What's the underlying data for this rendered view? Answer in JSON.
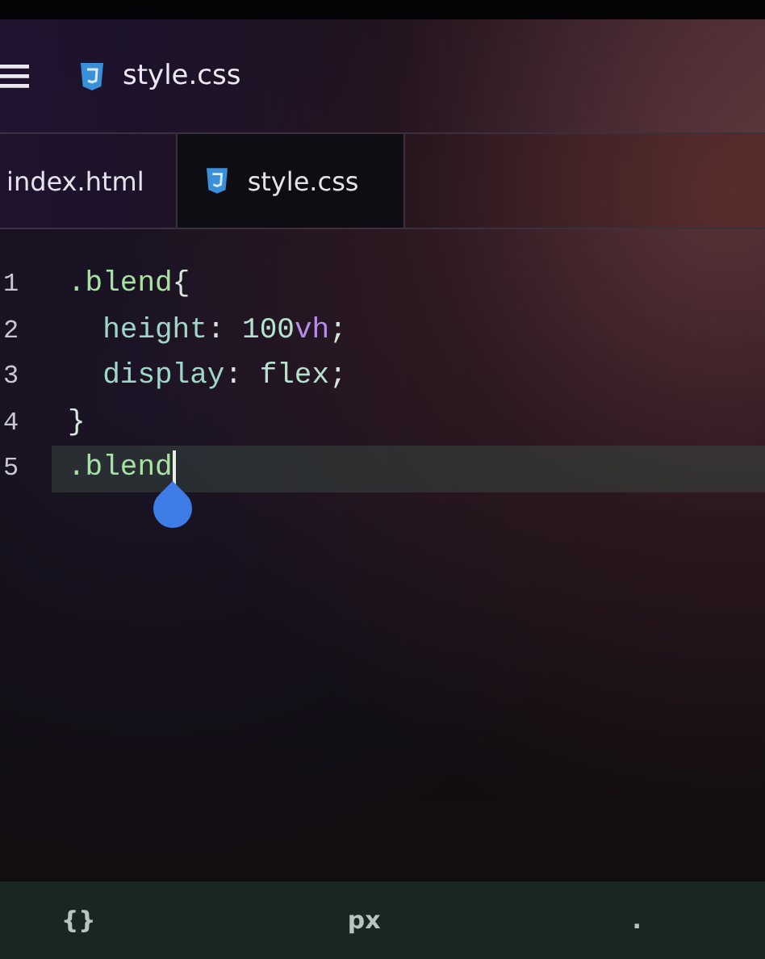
{
  "header": {
    "title": "style.css"
  },
  "tabs": [
    {
      "label": "index.html",
      "kind": "html",
      "selected": false
    },
    {
      "label": "style.css",
      "kind": "css",
      "selected": true
    }
  ],
  "editor": {
    "lines": [
      {
        "number": "1",
        "current": false,
        "tokens": [
          {
            "text": ".blend",
            "kind": "selector"
          },
          {
            "text": "{",
            "kind": "punct"
          }
        ]
      },
      {
        "number": "2",
        "current": false,
        "tokens": [
          {
            "text": "  height",
            "kind": "property"
          },
          {
            "text": ": ",
            "kind": "punct"
          },
          {
            "text": "100",
            "kind": "value"
          },
          {
            "text": "vh",
            "kind": "unit"
          },
          {
            "text": ";",
            "kind": "punct"
          }
        ]
      },
      {
        "number": "3",
        "current": false,
        "tokens": [
          {
            "text": "  display",
            "kind": "property"
          },
          {
            "text": ": ",
            "kind": "punct"
          },
          {
            "text": "flex",
            "kind": "value"
          },
          {
            "text": ";",
            "kind": "punct"
          }
        ]
      },
      {
        "number": "4",
        "current": false,
        "tokens": [
          {
            "text": "}",
            "kind": "punct"
          }
        ]
      },
      {
        "number": "5",
        "current": true,
        "tokens": [
          {
            "text": ".blend",
            "kind": "selector"
          }
        ]
      }
    ]
  },
  "keys": [
    "{}",
    "px",
    "."
  ]
}
